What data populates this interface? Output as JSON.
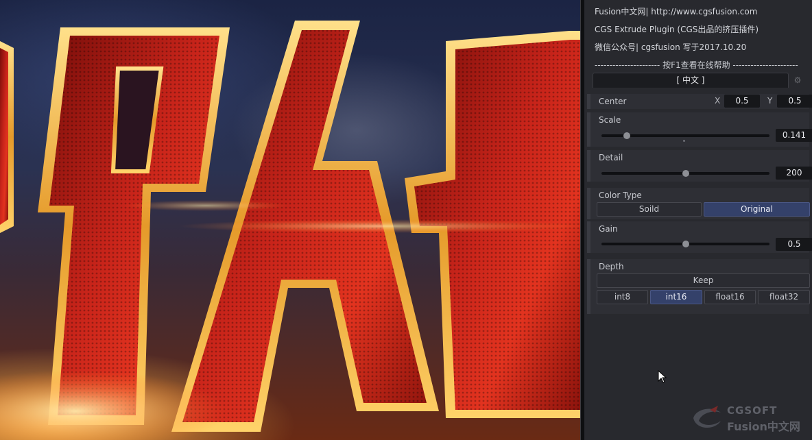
{
  "info": {
    "line1": "Fusion中文网| http://www.cgsfusion.com",
    "line2": "CGS Extrude Plugin (CGS出品的挤压插件)",
    "line3": "微信公众号|  cgsfusion    写于2017.10.20",
    "line4": "---------------------- 按F1查看在线帮助 ----------------------"
  },
  "tab": {
    "label": "[    中文    ]",
    "gear_icon": "gear-icon"
  },
  "center": {
    "label": "Center",
    "x_label": "X",
    "x_value": "0.5",
    "y_label": "Y",
    "y_value": "0.5"
  },
  "scale": {
    "label": "Scale",
    "value": "0.141",
    "fraction": 0.15
  },
  "detail": {
    "label": "Detail",
    "value": "200",
    "fraction": 0.5
  },
  "color_type": {
    "label": "Color Type",
    "options": [
      "Soild",
      "Original"
    ],
    "selected": "Original"
  },
  "gain": {
    "label": "Gain",
    "value": "0.5",
    "fraction": 0.5
  },
  "depth": {
    "label": "Depth",
    "keep_label": "Keep",
    "options": [
      "int8",
      "int16",
      "float16",
      "float32"
    ],
    "selected": "int16"
  },
  "watermark": {
    "line1": "CGSOFT",
    "line2": "Fusion中文网"
  },
  "colors": {
    "accent": "#34416a",
    "panel": "#28292e",
    "section": "#2e2f35",
    "numbox": "#16171a"
  }
}
